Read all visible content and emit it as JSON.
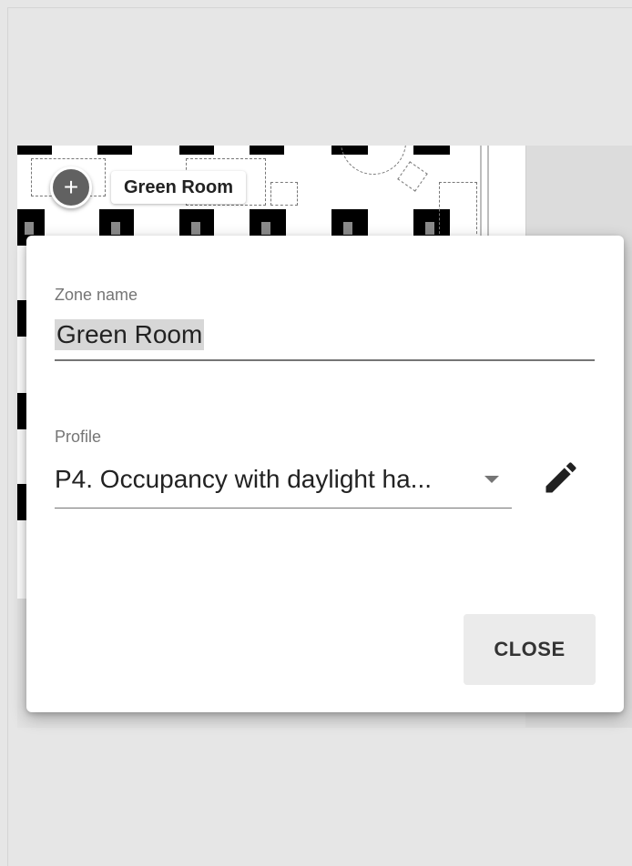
{
  "map": {
    "marker_icon": "plus-icon",
    "marker_symbol": "+",
    "marker_label": "Green Room"
  },
  "dialog": {
    "zone_name_label": "Zone name",
    "zone_name_value": "Green Room",
    "profile_label": "Profile",
    "profile_value": "P4. Occupancy with daylight ha...",
    "profile_dropdown_icon": "caret-down-icon",
    "edit_icon": "pencil-icon",
    "close_label": "CLOSE"
  }
}
